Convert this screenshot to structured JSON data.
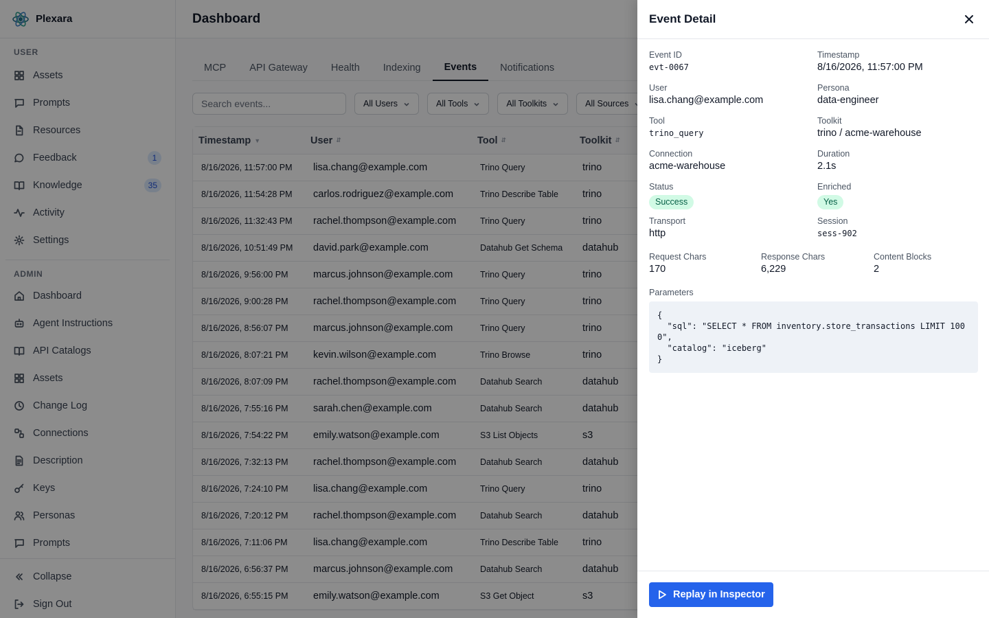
{
  "app": {
    "name": "Plexara"
  },
  "sidebar": {
    "user_label": "USER",
    "user_items": [
      {
        "label": "Assets",
        "icon": "grid-icon"
      },
      {
        "label": "Prompts",
        "icon": "message-square-icon"
      },
      {
        "label": "Resources",
        "icon": "file-icon"
      },
      {
        "label": "Feedback",
        "icon": "message-circle-icon",
        "badge": "1"
      },
      {
        "label": "Knowledge",
        "icon": "book-open-icon",
        "badge": "35"
      },
      {
        "label": "Activity",
        "icon": "activity-icon"
      },
      {
        "label": "Settings",
        "icon": "gear-icon"
      }
    ],
    "admin_label": "ADMIN",
    "admin_items": [
      {
        "label": "Dashboard",
        "icon": "home-icon"
      },
      {
        "label": "Agent Instructions",
        "icon": "bot-icon"
      },
      {
        "label": "API Catalogs",
        "icon": "book-open-icon"
      },
      {
        "label": "Assets",
        "icon": "grid-icon"
      },
      {
        "label": "Change Log",
        "icon": "clock-icon"
      },
      {
        "label": "Connections",
        "icon": "link-icon"
      },
      {
        "label": "Description",
        "icon": "file-text-icon"
      },
      {
        "label": "Keys",
        "icon": "key-icon"
      },
      {
        "label": "Personas",
        "icon": "users-icon"
      },
      {
        "label": "Prompts",
        "icon": "message-square-icon"
      }
    ],
    "collapse_label": "Collapse",
    "signout_label": "Sign Out"
  },
  "main": {
    "title": "Dashboard",
    "tabs": [
      "MCP",
      "API Gateway",
      "Health",
      "Indexing",
      "Events",
      "Notifications"
    ],
    "active_tab": "Events",
    "search_placeholder": "Search events...",
    "filters": [
      "All Users",
      "All Tools",
      "All Toolkits",
      "All Sources"
    ],
    "columns": [
      "Timestamp",
      "User",
      "Tool",
      "Toolkit"
    ],
    "rows": [
      {
        "ts": "8/16/2026, 11:57:00 PM",
        "user": "lisa.chang@example.com",
        "tool": "Trino Query",
        "kit": "trino"
      },
      {
        "ts": "8/16/2026, 11:54:28 PM",
        "user": "carlos.rodriguez@example.com",
        "tool": "Trino Describe Table",
        "kit": "trino"
      },
      {
        "ts": "8/16/2026, 11:32:43 PM",
        "user": "rachel.thompson@example.com",
        "tool": "Trino Query",
        "kit": "trino"
      },
      {
        "ts": "8/16/2026, 10:51:49 PM",
        "user": "david.park@example.com",
        "tool": "Datahub Get Schema",
        "kit": "datahub"
      },
      {
        "ts": "8/16/2026, 9:56:00 PM",
        "user": "marcus.johnson@example.com",
        "tool": "Trino Query",
        "kit": "trino"
      },
      {
        "ts": "8/16/2026, 9:00:28 PM",
        "user": "rachel.thompson@example.com",
        "tool": "Trino Query",
        "kit": "trino"
      },
      {
        "ts": "8/16/2026, 8:56:07 PM",
        "user": "marcus.johnson@example.com",
        "tool": "Trino Query",
        "kit": "trino"
      },
      {
        "ts": "8/16/2026, 8:07:21 PM",
        "user": "kevin.wilson@example.com",
        "tool": "Trino Browse",
        "kit": "trino"
      },
      {
        "ts": "8/16/2026, 8:07:09 PM",
        "user": "rachel.thompson@example.com",
        "tool": "Datahub Search",
        "kit": "datahub"
      },
      {
        "ts": "8/16/2026, 7:55:16 PM",
        "user": "sarah.chen@example.com",
        "tool": "Datahub Search",
        "kit": "datahub"
      },
      {
        "ts": "8/16/2026, 7:54:22 PM",
        "user": "emily.watson@example.com",
        "tool": "S3 List Objects",
        "kit": "s3"
      },
      {
        "ts": "8/16/2026, 7:32:13 PM",
        "user": "rachel.thompson@example.com",
        "tool": "Datahub Search",
        "kit": "datahub"
      },
      {
        "ts": "8/16/2026, 7:24:10 PM",
        "user": "lisa.chang@example.com",
        "tool": "Trino Query",
        "kit": "trino"
      },
      {
        "ts": "8/16/2026, 7:20:12 PM",
        "user": "rachel.thompson@example.com",
        "tool": "Datahub Search",
        "kit": "datahub"
      },
      {
        "ts": "8/16/2026, 7:11:06 PM",
        "user": "lisa.chang@example.com",
        "tool": "Trino Describe Table",
        "kit": "trino"
      },
      {
        "ts": "8/16/2026, 6:56:37 PM",
        "user": "marcus.johnson@example.com",
        "tool": "Datahub Search",
        "kit": "datahub"
      },
      {
        "ts": "8/16/2026, 6:55:15 PM",
        "user": "emily.watson@example.com",
        "tool": "S3 Get Object",
        "kit": "s3"
      }
    ]
  },
  "drawer": {
    "title": "Event Detail",
    "event_id_label": "Event ID",
    "event_id": "evt-0067",
    "timestamp_label": "Timestamp",
    "timestamp": "8/16/2026, 11:57:00 PM",
    "user_label": "User",
    "user": "lisa.chang@example.com",
    "persona_label": "Persona",
    "persona": "data-engineer",
    "tool_label": "Tool",
    "tool": "trino_query",
    "toolkit_label": "Toolkit",
    "toolkit": "trino / acme-warehouse",
    "connection_label": "Connection",
    "connection": "acme-warehouse",
    "duration_label": "Duration",
    "duration": "2.1s",
    "status_label": "Status",
    "status": "Success",
    "enriched_label": "Enriched",
    "enriched": "Yes",
    "transport_label": "Transport",
    "transport": "http",
    "session_label": "Session",
    "session": "sess-902",
    "request_chars_label": "Request Chars",
    "request_chars": "170",
    "response_chars_label": "Response Chars",
    "response_chars": "6,229",
    "content_blocks_label": "Content Blocks",
    "content_blocks": "2",
    "parameters_label": "Parameters",
    "parameters": "{\n  \"sql\": \"SELECT * FROM inventory.store_transactions LIMIT 1000\",\n  \"catalog\": \"iceberg\"\n}",
    "replay_label": "Replay in Inspector"
  },
  "colors": {
    "accent": "#2563eb",
    "success_bg": "#d1fae5",
    "success_text": "#065f46",
    "badge_bg": "#dbeafe"
  }
}
